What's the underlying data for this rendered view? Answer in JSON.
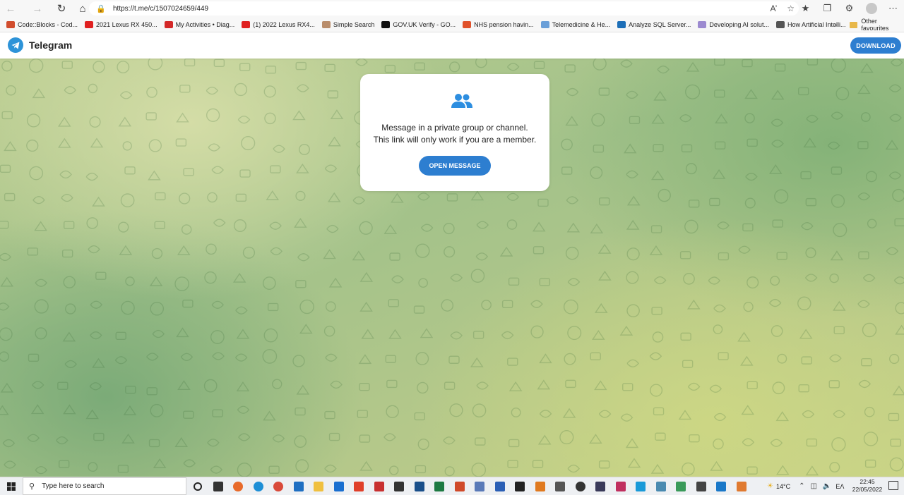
{
  "browser": {
    "url": "https://t.me/c/1507024659/449",
    "bookmarks": [
      {
        "label": "Code::Blocks - Cod...",
        "color": "#d14d2d"
      },
      {
        "label": "2021 Lexus RX 450...",
        "color": "#e02020"
      },
      {
        "label": "My Activities • Diag...",
        "color": "#d42828"
      },
      {
        "label": "(1) 2022 Lexus RX4...",
        "color": "#e02020"
      },
      {
        "label": "Simple Search",
        "color": "#b98d6b"
      },
      {
        "label": "GOV.UK Verify - GO...",
        "color": "#111111"
      },
      {
        "label": "NHS pension havin...",
        "color": "#e0512a"
      },
      {
        "label": "Telemedicine & He...",
        "color": "#6a9fd8"
      },
      {
        "label": "Analyze SQL Server...",
        "color": "#1d6fb8"
      },
      {
        "label": "Developing AI solut...",
        "color": "#9c8ad0"
      },
      {
        "label": "How Artificial Intelli...",
        "color": "#555555"
      }
    ],
    "other_favourites": "Other favourites",
    "icons": [
      "back-icon",
      "forward-icon",
      "refresh-icon",
      "home-icon",
      "lock-icon",
      "read-aloud-icon",
      "add-favorite-icon",
      "favorites-icon",
      "collections-icon",
      "extensions-icon",
      "profile-icon",
      "more-icon"
    ]
  },
  "telegram": {
    "brand": "Telegram",
    "download": "DOWNLOAD",
    "message_line1": "Message in a private group or channel.",
    "message_line2": "This link will only work if you are a member.",
    "open_message": "OPEN MESSAGE",
    "accent": "#2d7ed0"
  },
  "taskbar": {
    "search_placeholder": "Type here to search",
    "apps": [
      {
        "name": "cortana",
        "color": "#222222"
      },
      {
        "name": "task-view",
        "color": "#333333"
      },
      {
        "name": "firefox",
        "color": "#e86a2a"
      },
      {
        "name": "edge",
        "color": "#1e8fd6"
      },
      {
        "name": "chrome",
        "color": "#d94a3a"
      },
      {
        "name": "store",
        "color": "#1f6fc2"
      },
      {
        "name": "file-explorer",
        "color": "#f0c040"
      },
      {
        "name": "mail",
        "color": "#1a6fd0"
      },
      {
        "name": "office",
        "color": "#e0402a"
      },
      {
        "name": "app-red",
        "color": "#c83030"
      },
      {
        "name": "app-dark",
        "color": "#333333"
      },
      {
        "name": "app-blue-box",
        "color": "#1a4f8a"
      },
      {
        "name": "excel",
        "color": "#1e7a43"
      },
      {
        "name": "powerpoint",
        "color": "#d04a2a"
      },
      {
        "name": "calculator",
        "color": "#5a7ab8"
      },
      {
        "name": "word",
        "color": "#2b5fb5"
      },
      {
        "name": "app-k",
        "color": "#222222"
      },
      {
        "name": "sublime",
        "color": "#e07a20"
      },
      {
        "name": "app-gray",
        "color": "#555555"
      },
      {
        "name": "app-circle",
        "color": "#333333"
      },
      {
        "name": "app-obs",
        "color": "#3a3a5a"
      },
      {
        "name": "app-star",
        "color": "#c03060"
      },
      {
        "name": "skype",
        "color": "#1a9ad8"
      },
      {
        "name": "app-teal",
        "color": "#4a8ab0"
      },
      {
        "name": "app-green",
        "color": "#3a9a5a"
      },
      {
        "name": "app-monitor",
        "color": "#444444"
      },
      {
        "name": "vscode",
        "color": "#1a78c8"
      },
      {
        "name": "app-orange",
        "color": "#e07a30"
      }
    ],
    "temperature": "14°C",
    "language": "EΛ",
    "time": "22:45",
    "date": "22/05/2022"
  }
}
